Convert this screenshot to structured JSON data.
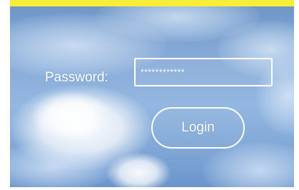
{
  "login_form": {
    "password_label": "Password:",
    "password_value": "************",
    "login_label": "Login"
  },
  "colors": {
    "top_bar": "#f7ee3a",
    "sky": "#88acd8",
    "foreground": "#ffffff"
  }
}
